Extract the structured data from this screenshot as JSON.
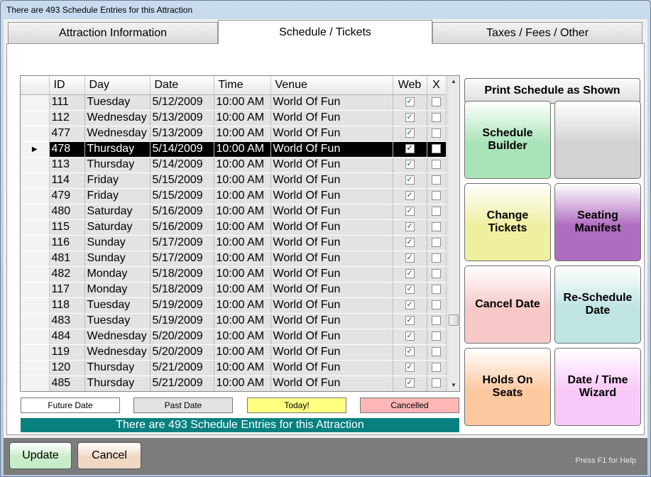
{
  "window": {
    "title": "There are 493 Schedule Entries for this Attraction"
  },
  "tabs": [
    {
      "label": "Attraction Information",
      "active": false
    },
    {
      "label": "Schedule / Tickets",
      "active": true
    },
    {
      "label": "Taxes / Fees / Other",
      "active": false
    }
  ],
  "grid": {
    "columns": [
      "ID",
      "Day",
      "Date",
      "Time",
      "Venue",
      "Web",
      "X"
    ],
    "selected_row_marker": "▶",
    "rows": [
      {
        "id": "111",
        "day": "Tuesday",
        "date": "5/12/2009",
        "time": "10:00 AM",
        "venue": "World Of Fun",
        "web": true,
        "x": false
      },
      {
        "id": "112",
        "day": "Wednesday",
        "date": "5/13/2009",
        "time": "10:00 AM",
        "venue": "World Of Fun",
        "web": true,
        "x": false
      },
      {
        "id": "477",
        "day": "Wednesday",
        "date": "5/13/2009",
        "time": "10:00 AM",
        "venue": "World Of Fun",
        "web": true,
        "x": false
      },
      {
        "id": "478",
        "day": "Thursday",
        "date": "5/14/2009",
        "time": "10:00 AM",
        "venue": "World Of Fun",
        "web": true,
        "x": false,
        "selected": true
      },
      {
        "id": "113",
        "day": "Thursday",
        "date": "5/14/2009",
        "time": "10:00 AM",
        "venue": "World Of Fun",
        "web": true,
        "x": false
      },
      {
        "id": "114",
        "day": "Friday",
        "date": "5/15/2009",
        "time": "10:00 AM",
        "venue": "World Of Fun",
        "web": true,
        "x": false
      },
      {
        "id": "479",
        "day": "Friday",
        "date": "5/15/2009",
        "time": "10:00 AM",
        "venue": "World Of Fun",
        "web": true,
        "x": false
      },
      {
        "id": "480",
        "day": "Saturday",
        "date": "5/16/2009",
        "time": "10:00 AM",
        "venue": "World Of Fun",
        "web": true,
        "x": false
      },
      {
        "id": "115",
        "day": "Saturday",
        "date": "5/16/2009",
        "time": "10:00 AM",
        "venue": "World Of Fun",
        "web": true,
        "x": false
      },
      {
        "id": "116",
        "day": "Sunday",
        "date": "5/17/2009",
        "time": "10:00 AM",
        "venue": "World Of Fun",
        "web": true,
        "x": false
      },
      {
        "id": "481",
        "day": "Sunday",
        "date": "5/17/2009",
        "time": "10:00 AM",
        "venue": "World Of Fun",
        "web": true,
        "x": false
      },
      {
        "id": "482",
        "day": "Monday",
        "date": "5/18/2009",
        "time": "10:00 AM",
        "venue": "World Of Fun",
        "web": true,
        "x": false
      },
      {
        "id": "117",
        "day": "Monday",
        "date": "5/18/2009",
        "time": "10:00 AM",
        "venue": "World Of Fun",
        "web": true,
        "x": false
      },
      {
        "id": "118",
        "day": "Tuesday",
        "date": "5/19/2009",
        "time": "10:00 AM",
        "venue": "World Of Fun",
        "web": true,
        "x": false
      },
      {
        "id": "483",
        "day": "Tuesday",
        "date": "5/19/2009",
        "time": "10:00 AM",
        "venue": "World Of Fun",
        "web": true,
        "x": false
      },
      {
        "id": "484",
        "day": "Wednesday",
        "date": "5/20/2009",
        "time": "10:00 AM",
        "venue": "World Of Fun",
        "web": true,
        "x": false
      },
      {
        "id": "119",
        "day": "Wednesday",
        "date": "5/20/2009",
        "time": "10:00 AM",
        "venue": "World Of Fun",
        "web": true,
        "x": false
      },
      {
        "id": "120",
        "day": "Thursday",
        "date": "5/21/2009",
        "time": "10:00 AM",
        "venue": "World Of Fun",
        "web": true,
        "x": false
      },
      {
        "id": "485",
        "day": "Thursday",
        "date": "5/21/2009",
        "time": "10:00 AM",
        "venue": "World Of Fun",
        "web": true,
        "x": false
      }
    ]
  },
  "legend": {
    "future": {
      "label": "Future Date",
      "color": "#ffffff"
    },
    "past": {
      "label": "Past Date",
      "color": "#e3e3e3"
    },
    "today": {
      "label": "Today!",
      "color": "#ffff80"
    },
    "cancelled": {
      "label": "Cancelled",
      "color": "#ffb6b6"
    }
  },
  "status_banner": "There are 493 Schedule Entries for this Attraction",
  "actions": {
    "print_schedule": "Print Schedule as Shown",
    "schedule_builder": "Schedule\nBuilder",
    "blank_button": "",
    "change_tickets": "Change\nTickets",
    "seating_manifest": "Seating\nManifest",
    "cancel_date": "Cancel Date",
    "reschedule_date": "Re-Schedule\nDate",
    "holds_on_seats": "Holds On\nSeats",
    "date_time_wizard": "Date / Time\nWizard"
  },
  "colors": {
    "schedule_builder": "#a8e4b8",
    "blank_button": "#d2d2d2",
    "change_tickets": "#eef0a0",
    "seating_manifest": "#b06cc0",
    "cancel_date": "#f6c8c8",
    "reschedule_date": "#bfe4e2",
    "holds_on_seats": "#fbc8a0",
    "date_time_wizard": "#f8c8f8",
    "update": "#c8ecc8",
    "cancel": "#f0d8c4",
    "banner": "#088080"
  },
  "footer": {
    "update": "Update",
    "cancel": "Cancel",
    "help": "Press F1 for Help"
  }
}
